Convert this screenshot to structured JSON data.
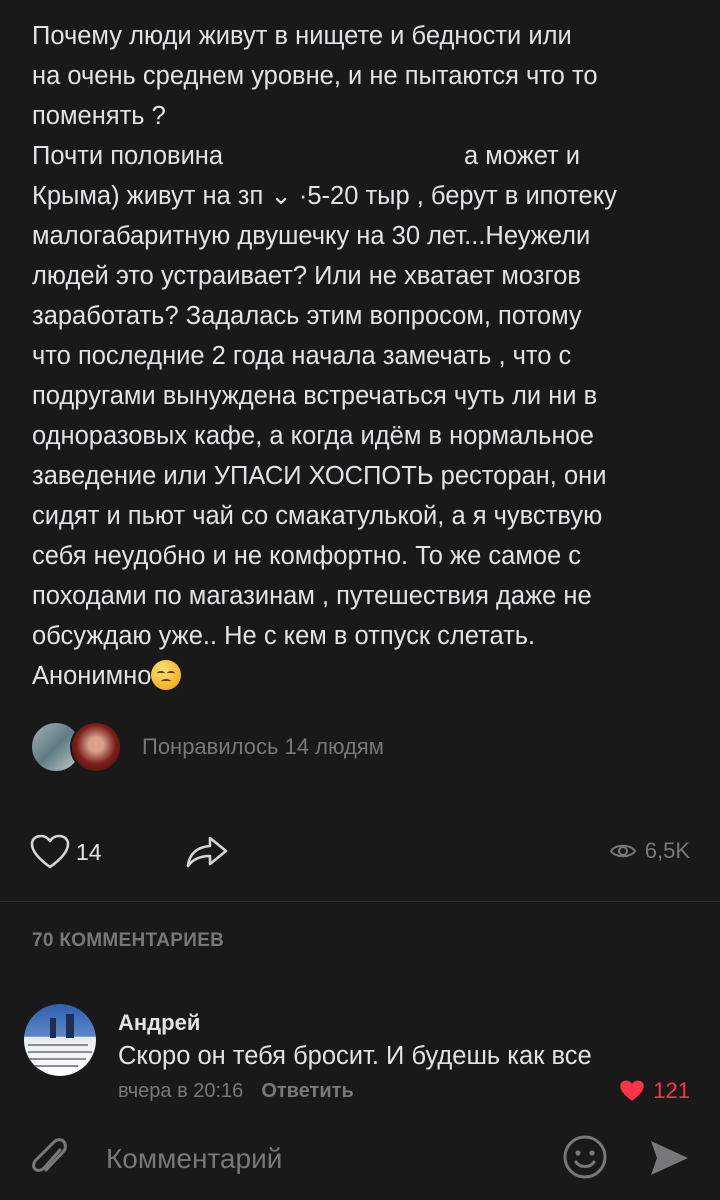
{
  "post": {
    "text": "Почему люди живут в нищете и бедности или\nна очень среднем уровне, и не пытаются что то\nпоменять ?\nПочти половина                                  а может и\nКрыма) живут на зп ⌄ ·5-20 тыр , берут в ипотеку\nмалогабаритную двушечку на 30 лет...Неужели\nлюдей это устраивает? Или не хватает мозгов\nзаработать? Задалась этим вопросом, потому\nчто последние 2 года начала замечать , что с\nподругами вынуждена встречаться чуть ли ни в\nодноразовых кафе, а когда идём в нормальное\nзаведение или УПАСИ ХОСПОТЬ ресторан, они\nсидят и пьют чай со смакатулькой, а я чувствую\nсебя неудобно и не комфортно. То же самое с\nпоходами по магазинам , путешествия даже не\nобсуждаю уже.. Не с кем в отпуск слетать.\nАнонимно",
    "emoji_icon": "pensive-face-icon"
  },
  "likes": {
    "liked_by_text": "Понравилось 14 людям",
    "count": "14"
  },
  "stats": {
    "views": "6,5K"
  },
  "comments": {
    "header": "70 КОММЕНТАРИЕВ",
    "items": [
      {
        "author": "Андрей",
        "text": "Скоро он тебя бросит. И будешь как все",
        "time": "вчера в 20:16",
        "reply_label": "Ответить",
        "likes": "121"
      }
    ]
  },
  "composer": {
    "placeholder": "Комментарий"
  },
  "colors": {
    "background": "#191919",
    "text_primary": "#e1e3e6",
    "text_secondary": "#76787a",
    "like_red": "#ff3347"
  }
}
